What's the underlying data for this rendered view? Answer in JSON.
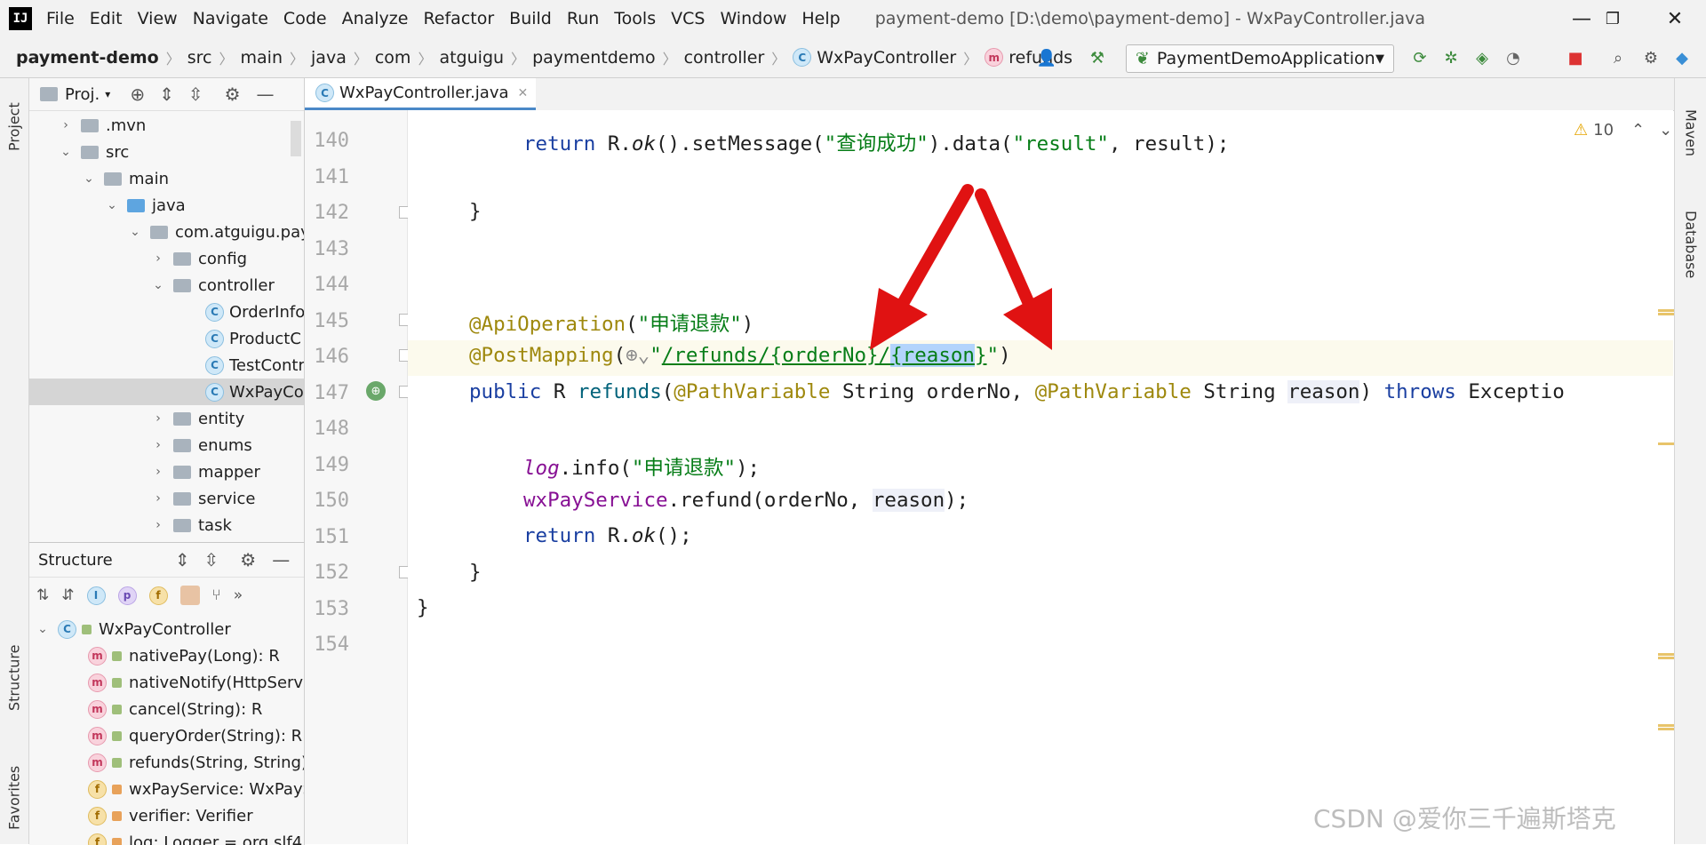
{
  "menubar": {
    "items": [
      "File",
      "Edit",
      "View",
      "Navigate",
      "Code",
      "Analyze",
      "Refactor",
      "Build",
      "Run",
      "Tools",
      "VCS",
      "Window",
      "Help"
    ],
    "window_title": "payment-demo [D:\\demo\\payment-demo] - WxPayController.java"
  },
  "navbar": {
    "project": "payment-demo",
    "crumbs": [
      "src",
      "main",
      "java",
      "com",
      "atguigu",
      "paymentdemo",
      "controller",
      "WxPayController",
      "refunds"
    ],
    "run_config": "PaymentDemoApplication"
  },
  "stripe": {
    "project": "Project",
    "structure": "Structure",
    "favorites": "Favorites",
    "maven": "Maven",
    "database": "Database"
  },
  "project_panel": {
    "title": "Proj.",
    "tree": [
      ".mvn",
      "src",
      "main",
      "java",
      "com.atguigu.pay",
      "config",
      "controller",
      "OrderInfo",
      "ProductC",
      "TestContr",
      "WxPayCo",
      "entity",
      "enums",
      "mapper",
      "service",
      "task"
    ]
  },
  "structure_panel": {
    "title": "Structure",
    "items": [
      "WxPayController",
      "nativePay(Long): R",
      "nativeNotify(HttpServle",
      "cancel(String): R",
      "queryOrder(String): R",
      "refunds(String, String):",
      "wxPayService: WxPayS",
      "verifier: Verifier",
      "log: Logger = org.slf4"
    ]
  },
  "editor": {
    "tab": "WxPayController.java",
    "warnings": "10",
    "line_numbers": [
      "140",
      "141",
      "142",
      "143",
      "144",
      "145",
      "146",
      "147",
      "148",
      "149",
      "150",
      "151",
      "152",
      "153",
      "154"
    ]
  },
  "watermark": "CSDN @爱你三千遍斯塔克"
}
